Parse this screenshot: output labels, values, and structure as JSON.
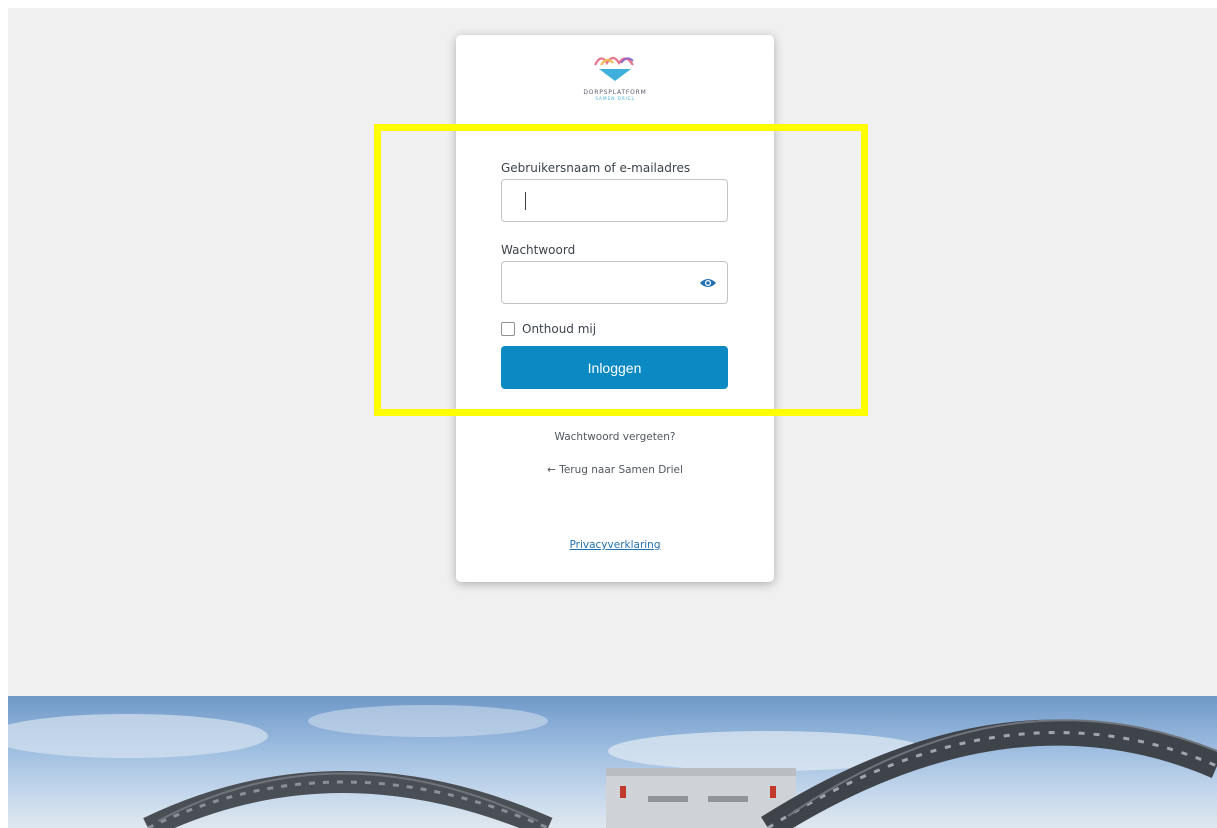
{
  "logo": {
    "name": "logo-icon",
    "title": "DORPSPLATFORM",
    "subtitle": "SAMEN DRIEL"
  },
  "form": {
    "username_label": "Gebruikersnaam of e-mailadres",
    "username_value": "",
    "password_label": "Wachtwoord",
    "password_value": "",
    "password_toggle_icon": "eye-icon",
    "remember_label": "Onthoud mij",
    "submit_label": "Inloggen"
  },
  "links": {
    "lost_password": "Wachtwoord vergeten?",
    "back_to_site": "← Terug naar Samen Driel",
    "privacy": "Privacyverklaring"
  },
  "colors": {
    "button": "#0a89c2",
    "highlight": "#ffff00",
    "background": "#f0f0f0"
  }
}
